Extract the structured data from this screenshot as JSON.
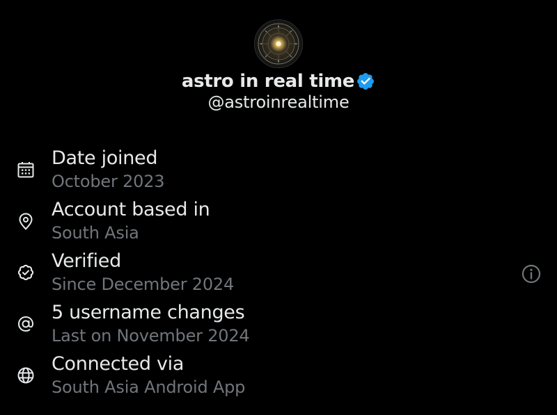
{
  "profile": {
    "display_name": "astro in real time",
    "handle": "@astroinrealtime",
    "verified_icon": "verified-check-icon",
    "avatar_icon": "astrology-wheel-avatar"
  },
  "about": {
    "items": [
      {
        "icon": "calendar-icon",
        "title": "Date joined",
        "subtitle": "October 2023"
      },
      {
        "icon": "location-pin-icon",
        "title": "Account based in",
        "subtitle": "South Asia"
      },
      {
        "icon": "verified-badge-icon",
        "title": "Verified",
        "subtitle": "Since December 2024",
        "has_info_button": true
      },
      {
        "icon": "at-sign-icon",
        "title": "5 username changes",
        "subtitle": "Last on November 2024"
      },
      {
        "icon": "globe-icon",
        "title": "Connected via",
        "subtitle": "South Asia Android App"
      }
    ],
    "info_button_icon": "info-circle-icon"
  },
  "colors": {
    "background": "#000000",
    "primary_text": "#e7e9ea",
    "secondary_text": "#71767b",
    "verified_blue": "#1d9bf0"
  }
}
